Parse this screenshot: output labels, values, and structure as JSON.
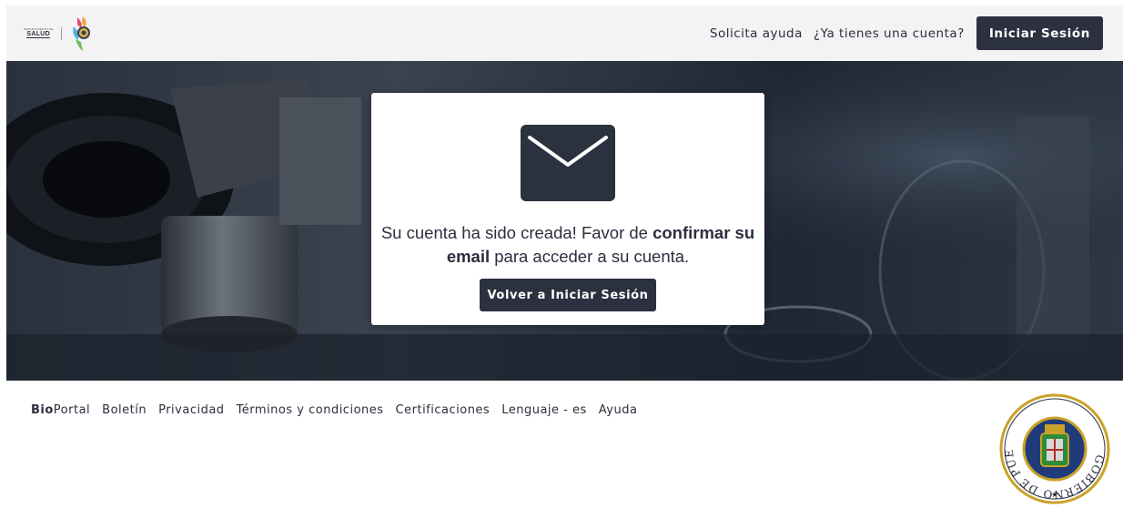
{
  "header": {
    "logo_small_text": "DEPARTAMENTO DE",
    "logo_word": "SALUD",
    "help_link": "Solicita ayuda",
    "account_prompt": "¿Ya tienes una cuenta?",
    "login_button": "Iniciar Sesión"
  },
  "card": {
    "icon": "envelope-icon",
    "message_part1": "Su cuenta ha sido creada! Favor de ",
    "message_bold": "confirmar su email",
    "message_part2": " para acceder a su cuenta.",
    "back_button": "Volver a Iniciar Sesión"
  },
  "footer": {
    "brand_bold": "Bio",
    "brand_rest": "Portal",
    "links": [
      "Boletín",
      "Privacidad",
      "Términos y condiciones",
      "Certificaciones",
      "Lenguaje - es",
      "Ayuda"
    ]
  },
  "seal": {
    "text": "GOBIERNO DE PUERTO RICO"
  },
  "colors": {
    "dark_button": "#2c3140",
    "header_bg": "#f3f3f4",
    "text": "#2b2f3e"
  }
}
